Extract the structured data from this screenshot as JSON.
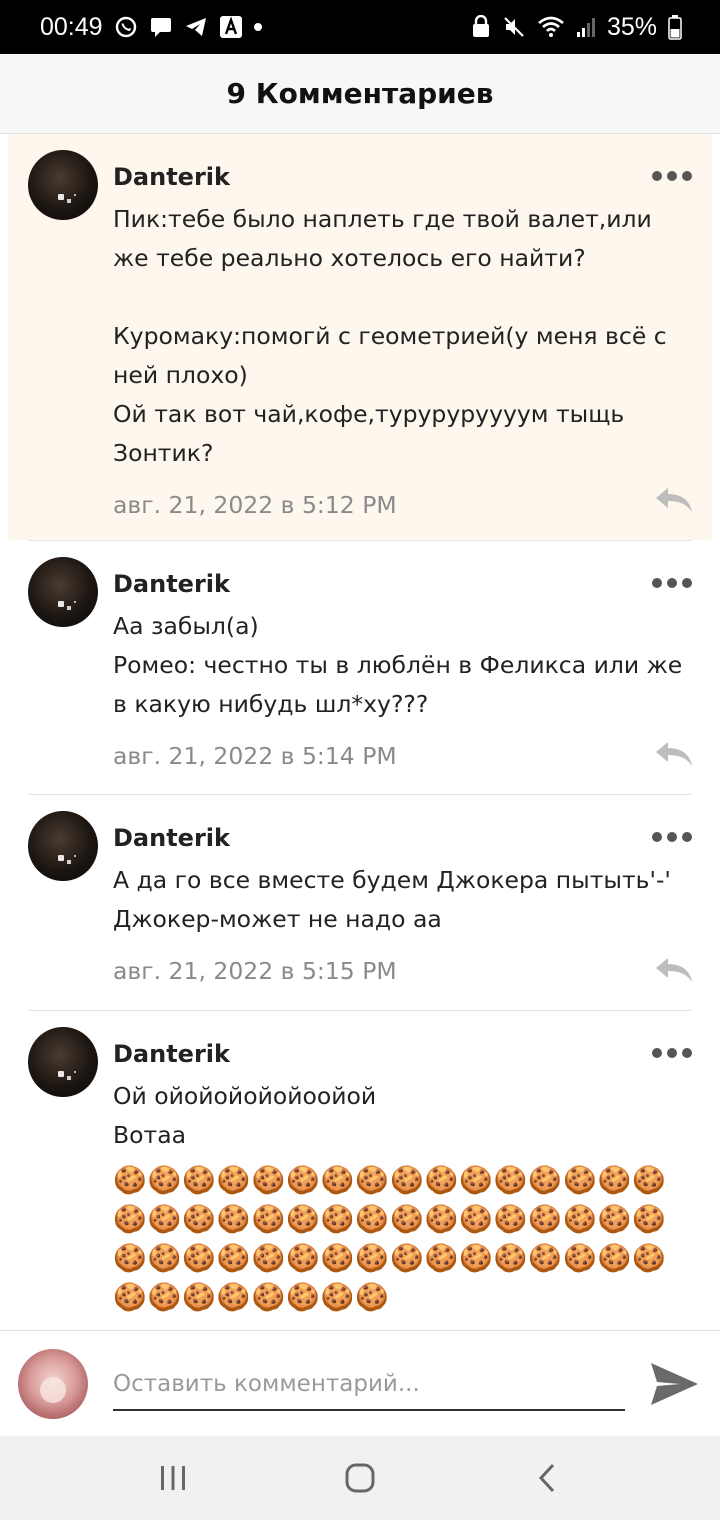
{
  "status_bar": {
    "time": "00:49",
    "battery": "35%"
  },
  "header": {
    "title": "9 Комментариев"
  },
  "comments": [
    {
      "author": "Danterik",
      "text": "Пик:тебе было наплеть где твой валет,или же тебе реально хотелось его найти?\n\nКуромаку:помогй с геометрией(у меня всё с ней плохо)\nОй так вот чай,кофе,туруруруууум тыщь Зонтик?",
      "date": "авг. 21, 2022 в 5:12 PM",
      "highlighted": true
    },
    {
      "author": "Danterik",
      "text": "Аа забыл(а)\nРомео: честно ты в люблён в Феликса или же в какую нибудь шл*ху???",
      "date": "авг. 21, 2022 в 5:14 PM",
      "highlighted": false
    },
    {
      "author": "Danterik",
      "text": "А да го все вместе будем Джокера пытыть'-'\nДжокер-может не надо аа",
      "date": "авг. 21, 2022 в 5:15 PM",
      "highlighted": false
    },
    {
      "author": "Danterik",
      "text": "Ой ойойойойойоойой\nВотаа",
      "cookies": "🍪🍪🍪🍪🍪🍪🍪🍪🍪🍪🍪🍪🍪🍪🍪🍪🍪🍪🍪🍪🍪🍪🍪🍪🍪🍪🍪🍪🍪🍪🍪🍪🍪🍪🍪🍪🍪🍪🍪🍪🍪🍪🍪🍪🍪🍪🍪🍪🍪🍪🍪🍪🍪🍪🍪🍪",
      "highlighted": false
    }
  ],
  "input": {
    "placeholder": "Оставить комментарий..."
  },
  "icons": {
    "more": "more-dots-icon",
    "reply": "reply-arrow-icon",
    "send": "send-icon",
    "nav_recent": "recent-apps-icon",
    "nav_home": "home-icon",
    "nav_back": "back-icon"
  },
  "colors": {
    "highlight_bg": "#fdf7ee",
    "date_text": "#8a8a8a",
    "status_bar_bg": "#000000",
    "header_bg": "#f7f7f7"
  }
}
